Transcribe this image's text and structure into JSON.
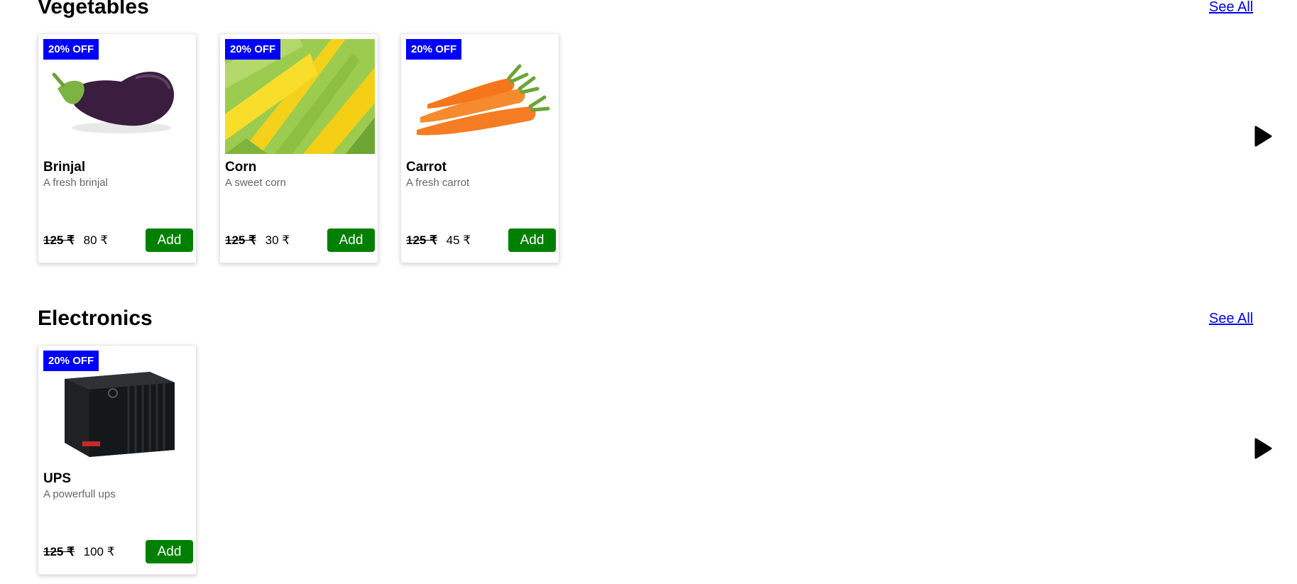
{
  "sections": [
    {
      "title": "Vegetables",
      "see_all": "See All",
      "products": [
        {
          "badge": "20% OFF",
          "name": "Brinjal",
          "description": "A fresh brinjal",
          "old_price": "125 ₹",
          "price": "80 ₹",
          "button": "Add",
          "image": "brinjal"
        },
        {
          "badge": "20% OFF",
          "name": "Corn",
          "description": "A sweet corn",
          "old_price": "125 ₹",
          "price": "30 ₹",
          "button": "Add",
          "image": "corn"
        },
        {
          "badge": "20% OFF",
          "name": "Carrot",
          "description": "A fresh carrot",
          "old_price": "125 ₹",
          "price": "45 ₹",
          "button": "Add",
          "image": "carrot"
        }
      ],
      "next_icon": "play-arrow-icon"
    },
    {
      "title": "Electronics",
      "see_all": "See All",
      "products": [
        {
          "badge": "20% OFF",
          "name": "UPS",
          "description": "A powerfull ups",
          "old_price": "125 ₹",
          "price": "100 ₹",
          "button": "Add",
          "image": "ups"
        }
      ],
      "next_icon": "play-arrow-icon"
    }
  ],
  "colors": {
    "badge": "#0000ff",
    "add_button": "#008000",
    "link": "#0000ee"
  }
}
